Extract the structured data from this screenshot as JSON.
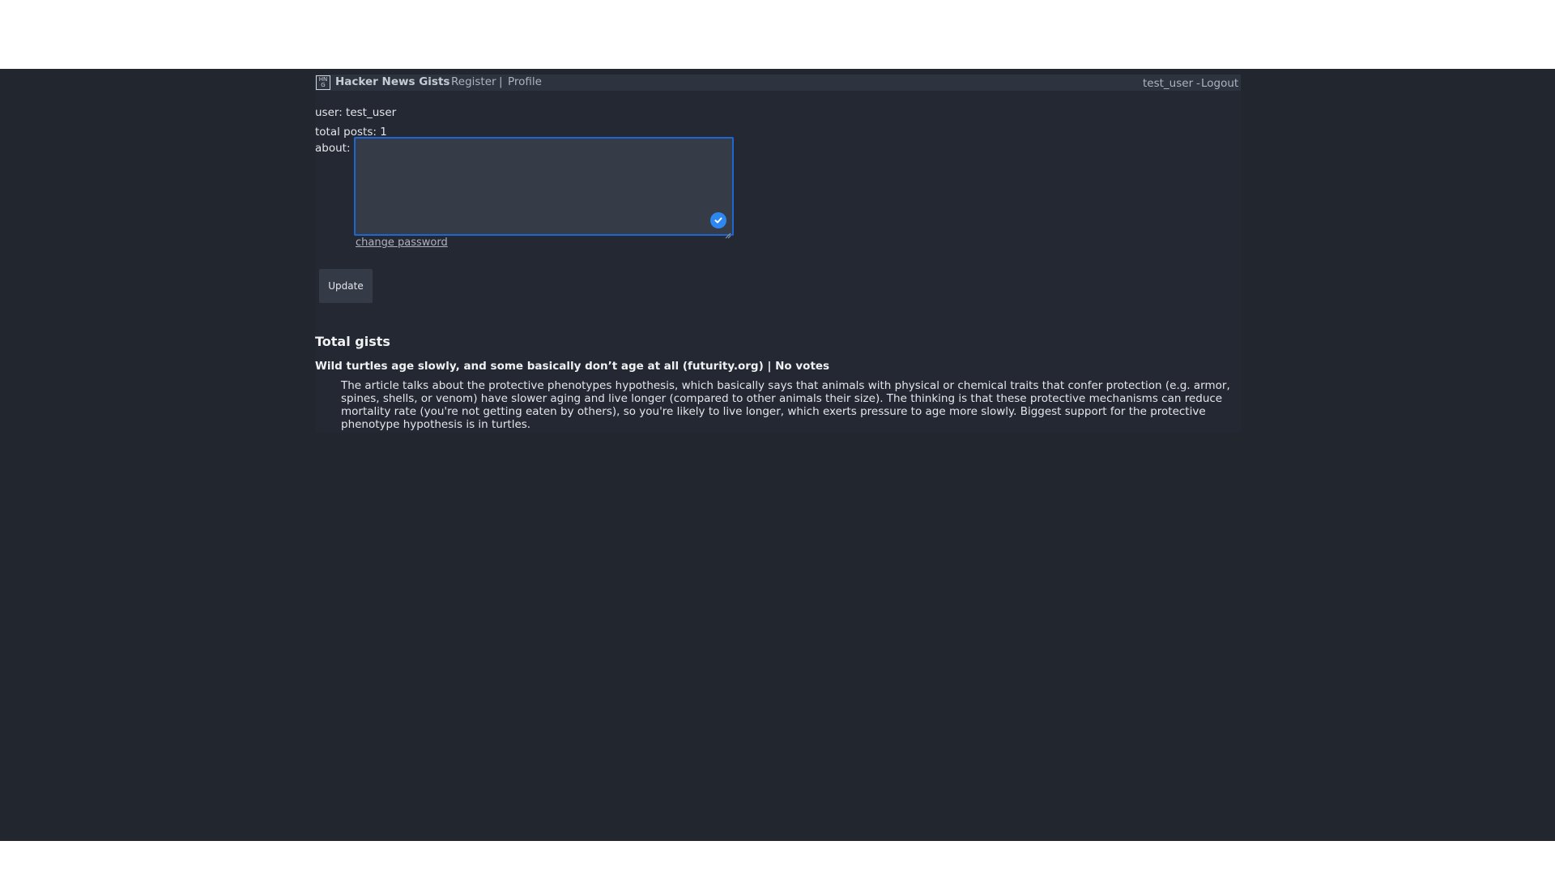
{
  "header": {
    "logo_line1": "HN",
    "logo_line2": "G",
    "site_name": "Hacker News Gists",
    "register_label": "Register",
    "separator": "|",
    "profile_label": "Profile",
    "username": "test_user",
    "logout_separator": "-",
    "logout_label": "Logout"
  },
  "profile": {
    "user_label": "user: test_user",
    "total_posts_label": "total posts: 1",
    "about_label": "about:",
    "about_value": "",
    "change_password_label": "change password",
    "update_label": "Update"
  },
  "gists": {
    "section_title": "Total gists",
    "items": [
      {
        "title": "Wild turtles age slowly, and some basically don’t age at all (futurity.org) | No votes",
        "body": "The article talks about the protective phenotypes hypothesis, which basically says that animals with physical or chemical traits that confer protection (e.g. armor, spines, shells, or venom) have slower aging and live longer (compared to other animals their size). The thinking is that these protective mechanisms can reduce mortality rate (you're not getting eaten by others), so you're likely to live longer, which exerts pressure to age more slowly. Biggest support for the protective phenotype hypothesis is in turtles."
      }
    ]
  },
  "colors": {
    "page_background": "#22262f",
    "header_background": "#2e3340",
    "focus_border": "#1f66d1",
    "check_accent": "#2e86f0"
  },
  "icons": {
    "logo": "hng-logo-icon",
    "textarea_check": "check-circle-icon",
    "resize_grip": "resize-grip-icon"
  }
}
